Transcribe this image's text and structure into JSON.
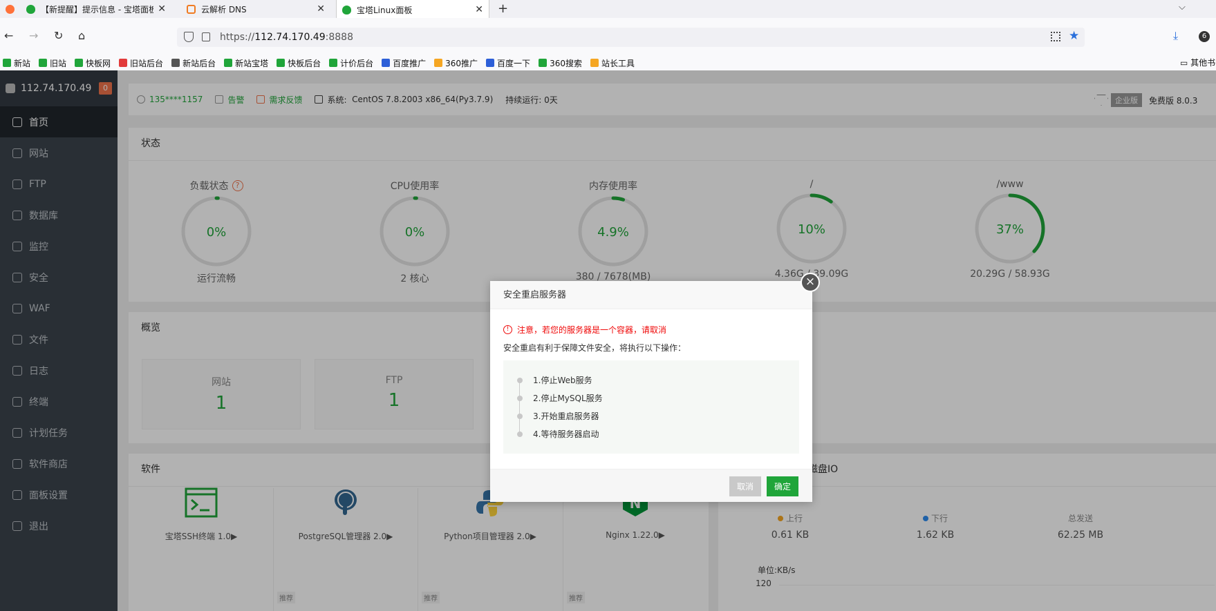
{
  "browser": {
    "tabs": [
      {
        "title": "【新提醒】提示信息 - 宝塔面板",
        "icon": "bt-shield-icon"
      },
      {
        "title": "云解析 DNS",
        "icon": "aliyun-icon"
      },
      {
        "title": "宝塔Linux面板",
        "icon": "bt-shield-icon"
      }
    ],
    "url_prefix": "https://",
    "url_host": "112.74.170.49",
    "url_port": ":8888",
    "downloads_badge": "6",
    "bookmarks": [
      "新站",
      "旧站",
      "快板网",
      "旧站后台",
      "新站后台",
      "新站宝塔",
      "快板后台",
      "计价后台",
      "百度推广",
      "360推广",
      "百度一下",
      "360搜索",
      "站长工具"
    ],
    "bookmarks_other": "其他书"
  },
  "sidebar": {
    "server_ip": "112.74.170.49",
    "alert_count": "0",
    "items": [
      {
        "label": "首页",
        "icon": "home-icon"
      },
      {
        "label": "网站",
        "icon": "globe-icon"
      },
      {
        "label": "FTP",
        "icon": "ftp-icon"
      },
      {
        "label": "数据库",
        "icon": "database-icon"
      },
      {
        "label": "监控",
        "icon": "monitor-icon"
      },
      {
        "label": "安全",
        "icon": "shield-icon"
      },
      {
        "label": "WAF",
        "icon": "waf-icon"
      },
      {
        "label": "文件",
        "icon": "folder-icon"
      },
      {
        "label": "日志",
        "icon": "log-icon"
      },
      {
        "label": "终端",
        "icon": "terminal-icon"
      },
      {
        "label": "计划任务",
        "icon": "calendar-icon"
      },
      {
        "label": "软件商店",
        "icon": "store-icon"
      },
      {
        "label": "面板设置",
        "icon": "gear-icon"
      },
      {
        "label": "退出",
        "icon": "logout-icon"
      }
    ]
  },
  "topinfo": {
    "user": "135****1157",
    "alarm": "告警",
    "feedback": "需求反馈",
    "system_label": "系统:",
    "system_value": "CentOS 7.8.2003 x86_64(Py3.7.9)",
    "uptime": "持续运行: 0天",
    "edition_badge": "企业版",
    "edition_text": "免费版 8.0.3"
  },
  "status": {
    "title": "状态",
    "gauges": [
      {
        "name": "负载状态",
        "value": "0%",
        "sub": "运行流畅",
        "fraction": 0.0,
        "help": "?"
      },
      {
        "name": "CPU使用率",
        "value": "0%",
        "sub": "2 核心",
        "fraction": 0.0
      },
      {
        "name": "内存使用率",
        "value": "4.9%",
        "sub": "380 / 7678(MB)",
        "fraction": 0.049
      },
      {
        "name": "/",
        "value": "10%",
        "sub": "4.36G / 39.09G",
        "fraction": 0.1
      },
      {
        "name": "/www",
        "value": "37%",
        "sub": "20.29G / 58.93G",
        "fraction": 0.37
      }
    ],
    "color_ok": "#20a53a"
  },
  "overview": {
    "title": "概览",
    "tiles": [
      {
        "label": "网站",
        "value": "1"
      },
      {
        "label": "FTP",
        "value": "1"
      }
    ]
  },
  "software": {
    "title": "软件",
    "items": [
      {
        "name": "宝塔SSH终端 1.0▶",
        "icon": "ssh-terminal-icon"
      },
      {
        "name": "PostgreSQL管理器 2.0▶",
        "icon": "postgresql-icon"
      },
      {
        "name": "Python项目管理器 2.0▶",
        "icon": "python-icon"
      },
      {
        "name": "Nginx 1.22.0▶",
        "icon": "nginx-icon"
      }
    ],
    "tag": "推荐"
  },
  "io": {
    "title": "磁盘IO",
    "stats": [
      {
        "label": "上行",
        "value": "0.61 KB",
        "dot": "#f5a623"
      },
      {
        "label": "下行",
        "value": "1.62 KB",
        "dot": "#2d8cf0"
      },
      {
        "label": "总发送",
        "value": "62.25 MB"
      }
    ],
    "unit": "单位:KB/s",
    "axis_top": "120"
  },
  "dialog": {
    "title": "安全重启服务器",
    "warning": "注意，若您的服务器是一个容器，请取消",
    "description": "安全重启有利于保障文件安全，将执行以下操作：",
    "steps": [
      "1.停止Web服务",
      "2.停止MySQL服务",
      "3.开始重启服务器",
      "4.等待服务器启动"
    ],
    "cancel": "取消",
    "confirm": "确定",
    "close": "×",
    "warn_icon": "!"
  }
}
